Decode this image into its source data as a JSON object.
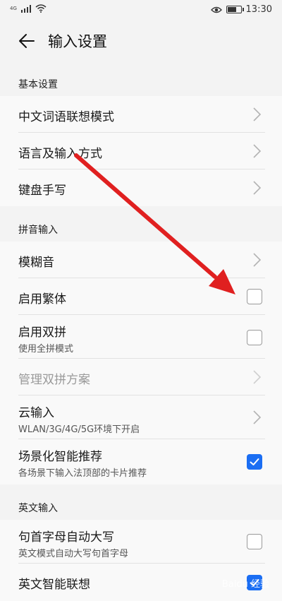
{
  "status_bar": {
    "signal": "4G",
    "time": "13:30"
  },
  "header": {
    "title": "输入设置"
  },
  "sections": {
    "basic": {
      "title": "基本设置",
      "items": [
        {
          "label": "中文词语联想模式"
        },
        {
          "label": "语言及输入方式"
        },
        {
          "label": "键盘手写"
        }
      ]
    },
    "pinyin": {
      "title": "拼音输入",
      "items": [
        {
          "label": "模糊音"
        },
        {
          "label": "启用繁体",
          "checked": false
        },
        {
          "label": "启用双拼",
          "sub": "使用全拼模式",
          "checked": false
        },
        {
          "label": "管理双拼方案",
          "disabled": true
        },
        {
          "label": "云输入",
          "sub": "WLAN/3G/4G/5G环境下开启"
        },
        {
          "label": "场景化智能推荐",
          "sub": "各场景下输入法顶部的卡片推荐",
          "checked": true
        }
      ]
    },
    "english": {
      "title": "英文输入",
      "items": [
        {
          "label": "句首字母自动大写",
          "sub": "英文模式自动大写句首字母",
          "checked": false
        },
        {
          "label": "英文智能联想",
          "checked": true
        }
      ]
    }
  },
  "watermark": "Baidu 经验",
  "colors": {
    "accent": "#1b6ef3",
    "arrow": "#e02020"
  }
}
